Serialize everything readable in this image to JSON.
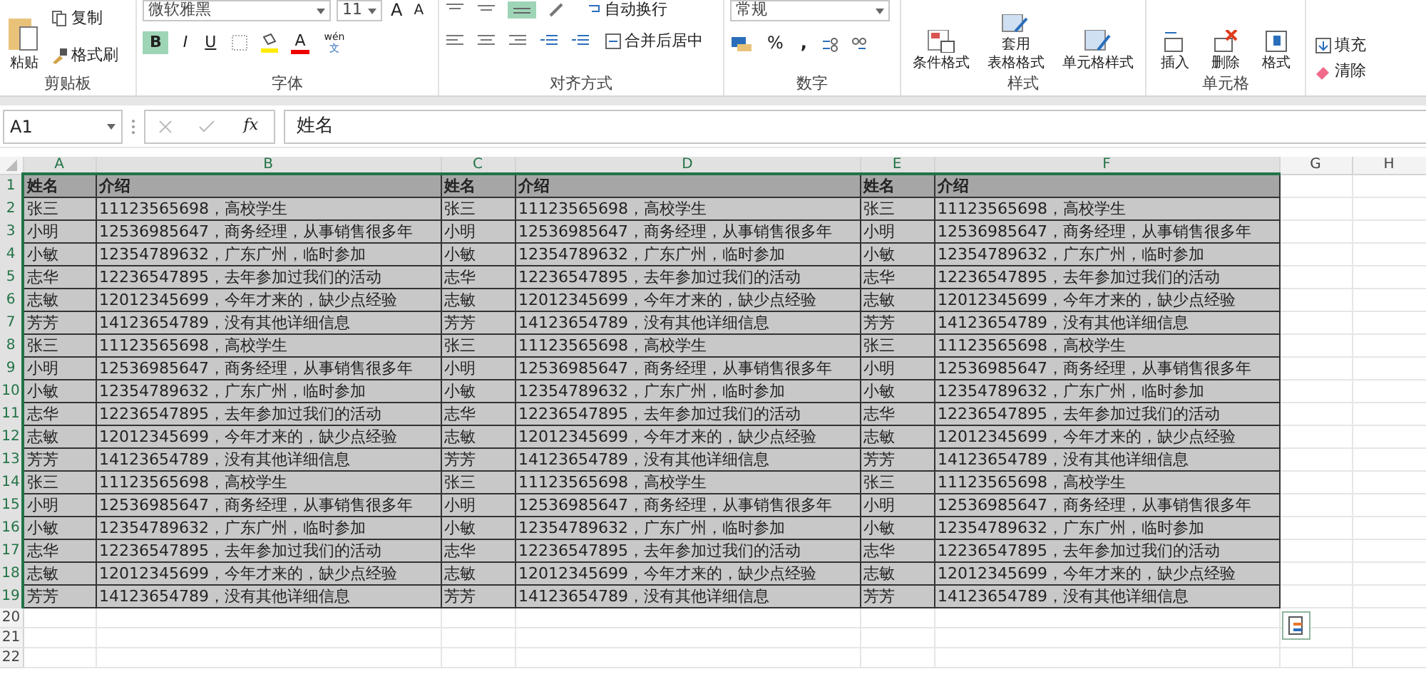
{
  "ribbon": {
    "clipboard": {
      "paste": "粘贴",
      "copy": "复制",
      "format_painter": "格式刷",
      "label": "剪贴板"
    },
    "font": {
      "font_name": "微软雅黑",
      "font_size": "11",
      "grow_font": "A",
      "shrink_font": "A",
      "bold": {
        "label": "B",
        "selected": true
      },
      "italic": "I",
      "underline": "U",
      "font_color": "A",
      "phonetic_guide": [
        "wén",
        "文"
      ],
      "label": "字体"
    },
    "alignment": {
      "middle_align": {
        "selected": true
      },
      "wrap_text": "自动换行",
      "merge_center": "合并后居中",
      "label": "对齐方式"
    },
    "number": {
      "format": "常规",
      "percent": "%",
      "comma": ",",
      "label": "数字"
    },
    "styles": {
      "conditional_format": "条件格式",
      "table_format": [
        "套用",
        "表格格式"
      ],
      "cell_styles": "单元格样式",
      "label": "样式"
    },
    "cells": {
      "insert": "插入",
      "delete": "删除",
      "format": "格式",
      "label": "单元格"
    },
    "editing": {
      "fill": "填充",
      "clear": "清除"
    }
  },
  "formula_bar": {
    "name_box": "A1",
    "function_label": "fx",
    "formula": "姓名"
  },
  "sheet": {
    "columns": [
      {
        "label": "A",
        "selected": true
      },
      {
        "label": "B",
        "selected": true
      },
      {
        "label": "C",
        "selected": true
      },
      {
        "label": "D",
        "selected": true
      },
      {
        "label": "E",
        "selected": true
      },
      {
        "label": "F",
        "selected": true
      },
      {
        "label": "G",
        "selected": false
      },
      {
        "label": "H",
        "selected": false
      }
    ],
    "rows": [
      {
        "number": "1",
        "selected": true,
        "kind": "header",
        "cells": [
          "姓名",
          "介绍",
          "姓名",
          "介绍",
          "姓名",
          "介绍"
        ]
      },
      {
        "number": "2",
        "selected": true,
        "kind": "data",
        "cells": [
          "张三",
          "11123565698，高校学生",
          "张三",
          "11123565698，高校学生",
          "张三",
          "11123565698，高校学生"
        ]
      },
      {
        "number": "3",
        "selected": true,
        "kind": "data",
        "cells": [
          "小明",
          "12536985647，商务经理，从事销售很多年",
          "小明",
          "12536985647，商务经理，从事销售很多年",
          "小明",
          "12536985647，商务经理，从事销售很多年"
        ]
      },
      {
        "number": "4",
        "selected": true,
        "kind": "data",
        "cells": [
          "小敏",
          "12354789632，广东广州，临时参加",
          "小敏",
          "12354789632，广东广州，临时参加",
          "小敏",
          "12354789632，广东广州，临时参加"
        ]
      },
      {
        "number": "5",
        "selected": true,
        "kind": "data",
        "cells": [
          "志华",
          "12236547895，去年参加过我们的活动",
          "志华",
          "12236547895，去年参加过我们的活动",
          "志华",
          "12236547895，去年参加过我们的活动"
        ]
      },
      {
        "number": "6",
        "selected": true,
        "kind": "data",
        "cells": [
          "志敏",
          "12012345699，今年才来的，缺少点经验",
          "志敏",
          "12012345699，今年才来的，缺少点经验",
          "志敏",
          "12012345699，今年才来的，缺少点经验"
        ]
      },
      {
        "number": "7",
        "selected": true,
        "kind": "data",
        "cells": [
          "芳芳",
          "14123654789，没有其他详细信息",
          "芳芳",
          "14123654789，没有其他详细信息",
          "芳芳",
          "14123654789，没有其他详细信息"
        ]
      },
      {
        "number": "8",
        "selected": true,
        "kind": "data",
        "cells": [
          "张三",
          "11123565698，高校学生",
          "张三",
          "11123565698，高校学生",
          "张三",
          "11123565698，高校学生"
        ]
      },
      {
        "number": "9",
        "selected": true,
        "kind": "data",
        "cells": [
          "小明",
          "12536985647，商务经理，从事销售很多年",
          "小明",
          "12536985647，商务经理，从事销售很多年",
          "小明",
          "12536985647，商务经理，从事销售很多年"
        ]
      },
      {
        "number": "10",
        "selected": true,
        "kind": "data",
        "cells": [
          "小敏",
          "12354789632，广东广州，临时参加",
          "小敏",
          "12354789632，广东广州，临时参加",
          "小敏",
          "12354789632，广东广州，临时参加"
        ]
      },
      {
        "number": "11",
        "selected": true,
        "kind": "data",
        "cells": [
          "志华",
          "12236547895，去年参加过我们的活动",
          "志华",
          "12236547895，去年参加过我们的活动",
          "志华",
          "12236547895，去年参加过我们的活动"
        ]
      },
      {
        "number": "12",
        "selected": true,
        "kind": "data",
        "cells": [
          "志敏",
          "12012345699，今年才来的，缺少点经验",
          "志敏",
          "12012345699，今年才来的，缺少点经验",
          "志敏",
          "12012345699，今年才来的，缺少点经验"
        ]
      },
      {
        "number": "13",
        "selected": true,
        "kind": "data",
        "cells": [
          "芳芳",
          "14123654789，没有其他详细信息",
          "芳芳",
          "14123654789，没有其他详细信息",
          "芳芳",
          "14123654789，没有其他详细信息"
        ]
      },
      {
        "number": "14",
        "selected": true,
        "kind": "data",
        "cells": [
          "张三",
          "11123565698，高校学生",
          "张三",
          "11123565698，高校学生",
          "张三",
          "11123565698，高校学生"
        ]
      },
      {
        "number": "15",
        "selected": true,
        "kind": "data",
        "cells": [
          "小明",
          "12536985647，商务经理，从事销售很多年",
          "小明",
          "12536985647，商务经理，从事销售很多年",
          "小明",
          "12536985647，商务经理，从事销售很多年"
        ]
      },
      {
        "number": "16",
        "selected": true,
        "kind": "data",
        "cells": [
          "小敏",
          "12354789632，广东广州，临时参加",
          "小敏",
          "12354789632，广东广州，临时参加",
          "小敏",
          "12354789632，广东广州，临时参加"
        ]
      },
      {
        "number": "17",
        "selected": true,
        "kind": "data",
        "cells": [
          "志华",
          "12236547895，去年参加过我们的活动",
          "志华",
          "12236547895，去年参加过我们的活动",
          "志华",
          "12236547895，去年参加过我们的活动"
        ]
      },
      {
        "number": "18",
        "selected": true,
        "kind": "data",
        "cells": [
          "志敏",
          "12012345699，今年才来的，缺少点经验",
          "志敏",
          "12012345699，今年才来的，缺少点经验",
          "志敏",
          "12012345699，今年才来的，缺少点经验"
        ]
      },
      {
        "number": "19",
        "selected": true,
        "kind": "data",
        "cells": [
          "芳芳",
          "14123654789，没有其他详细信息",
          "芳芳",
          "14123654789，没有其他详细信息",
          "芳芳",
          "14123654789，没有其他详细信息"
        ]
      },
      {
        "number": "20",
        "selected": false,
        "kind": "blank"
      },
      {
        "number": "21",
        "selected": false,
        "kind": "blank"
      },
      {
        "number": "22",
        "selected": false,
        "kind": "blank"
      }
    ]
  }
}
